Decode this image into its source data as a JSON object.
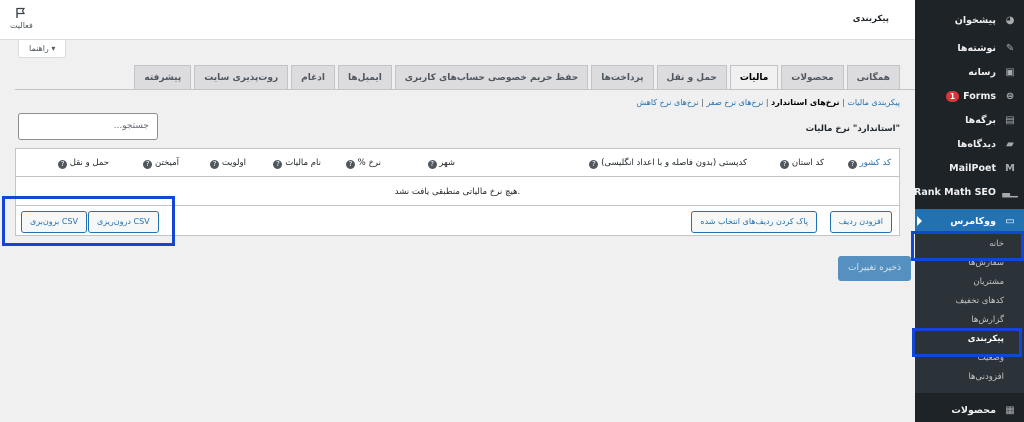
{
  "topbar": {
    "page_title": "پیکربندی",
    "activity_label": "فعالیت"
  },
  "help_tab": {
    "label": "راهنما ▾"
  },
  "sidebar": {
    "items": [
      {
        "label": "پیشخوان",
        "icon": "dashboard-icon"
      },
      {
        "label": "نوشته‌ها",
        "icon": "pin-icon"
      },
      {
        "label": "رسانه",
        "icon": "media-icon"
      },
      {
        "label": "Forms",
        "icon": "forms-icon",
        "badge": "1"
      },
      {
        "label": "برگه‌ها",
        "icon": "pages-icon"
      },
      {
        "label": "دیدگاه‌ها",
        "icon": "comments-icon"
      },
      {
        "label": "MailPoet",
        "icon": "mailpoet-icon"
      },
      {
        "label": "Rank Math SEO",
        "icon": "chart-icon"
      },
      {
        "label": "ووکامرس",
        "icon": "woocommerce-icon"
      }
    ],
    "sub_items": [
      "خانه",
      "سفارش‌ها",
      "مشتریان",
      "کدهای تخفیف",
      "گزارش‌ها",
      "پیکربندی",
      "وضعیت",
      "افزودنی‌ها"
    ],
    "bottom_item": {
      "label": "محصولات",
      "icon": "products-icon"
    }
  },
  "tabs": [
    "همگانی",
    "محصولات",
    "مالیات",
    "حمل و نقل",
    "پرداخت‌ها",
    "حفظ حریم خصوصی حساب‌های کاربری",
    "ایمیل‌ها",
    "ادغام",
    "روت‌پذیری سایت",
    "پیشرفته"
  ],
  "active_tab": "مالیات",
  "subsub": {
    "link1": "پیکربندی مالیات",
    "sep": "|",
    "current": "نرخ‌های استاندارد",
    "link2": "نرخ‌های نرخ صفر",
    "link3": "نرخ‌های نرخ کاهش"
  },
  "section_title": "\"استاندارد\" نرخ مالیات",
  "search": {
    "placeholder": "جستجو..."
  },
  "table": {
    "headers": {
      "country": "کشور",
      "country_code": "کد",
      "state": "کد استان",
      "postcode": "کدپستی (بدون فاصله و با اعداد انگلیسی)",
      "city": "شهر",
      "rate": "نرخ %",
      "tax_name": "نام مالیات",
      "priority": "اولویت",
      "compound": "آمیختن",
      "shipping": "حمل و نقل"
    },
    "empty_message": "هیچ نرخ مالیاتی منطبقی یافت نشد.",
    "buttons": {
      "insert_row": "افزودن ردیف",
      "remove_rows": "پاک کردن ردیف‌های انتخاب شده",
      "import_csv": "درون‌ریزی CSV",
      "export_csv": "برون‌بری CSV"
    }
  },
  "save_button": "ذخیره تغییرات",
  "colors": {
    "sidebar_bg": "#1d2327",
    "accent": "#2271b1",
    "highlight_outline": "#1446d6",
    "badge": "#d63638"
  }
}
